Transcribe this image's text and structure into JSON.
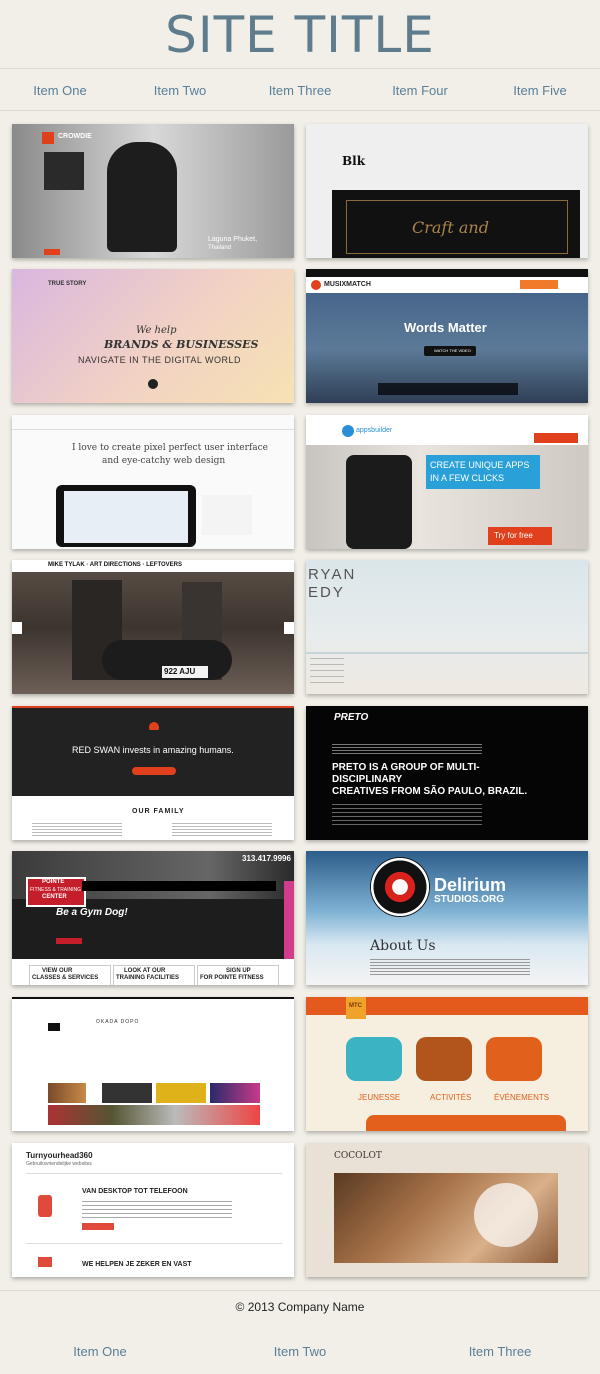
{
  "header": {
    "title": "SITE TITLE"
  },
  "nav": {
    "items": [
      "Item One",
      "Item Two",
      "Item Three",
      "Item Four",
      "Item Five"
    ]
  },
  "thumbnails": [
    {
      "name": "crowdie",
      "texts": [
        "CROWDIE",
        "Laguna Phuket,",
        "Thailand"
      ]
    },
    {
      "name": "blk",
      "texts": [
        "Blk",
        "Craft and"
      ]
    },
    {
      "name": "true-story",
      "texts": [
        "TRUE STORY",
        "We help",
        "BRANDS & BUSINESSES",
        "NAVIGATE IN THE DIGITAL WORLD"
      ]
    },
    {
      "name": "musixmatch",
      "texts": [
        "MUSIXMATCH",
        "Words Matter",
        "WATCH THE VIDEO"
      ]
    },
    {
      "name": "pixel-perfect",
      "texts": [
        "I love to create pixel perfect user interface",
        "and eye-catchy web design"
      ]
    },
    {
      "name": "appsbuilder",
      "texts": [
        "appsbuilder",
        "CREATE UNIQUE APPS",
        "IN A FEW CLICKS",
        "Try for free"
      ]
    },
    {
      "name": "mike-tylak",
      "texts": [
        "MIKE TYLAK · ART DIRECTIONS · LEFTOVERS",
        "922 AJU"
      ]
    },
    {
      "name": "ryan-edy",
      "texts": [
        "RYAN",
        "EDY"
      ]
    },
    {
      "name": "red-swan",
      "texts": [
        "RED SWAN invests in amazing humans.",
        "OUR FAMILY"
      ]
    },
    {
      "name": "preto",
      "texts": [
        "PRETO",
        "PRETO IS A GROUP OF MULTI-",
        "DISCIPLINARY",
        "CREATIVES FROM SÃO PAULO, BRAZIL."
      ]
    },
    {
      "name": "pointe-fitness",
      "texts": [
        "POINTE",
        "FITNESS & TRAINING",
        "CENTER",
        "Be a Gym Dog!",
        "VIEW OUR",
        "CLASSES & SERVICES",
        "LOOK AT OUR",
        "TRAINING FACILITIES",
        "SIGN UP",
        "FOR POINTE FITNESS",
        "313.417.9996"
      ]
    },
    {
      "name": "delirium",
      "texts": [
        "Delirium",
        "STUDIOS.ORG",
        "About Us"
      ]
    },
    {
      "name": "okada",
      "texts": [
        "OKADA DOPO"
      ]
    },
    {
      "name": "mtc",
      "texts": [
        "MTC",
        "JEUNESSE",
        "ACTIVITÉS",
        "ÉVÉNEMENTS"
      ]
    },
    {
      "name": "turnyourhead",
      "texts": [
        "Turnyourhead360",
        "Gebruiksvriendelijke websites",
        "VAN DESKTOP TOT TELEFOON",
        "WE HELPEN JE ZEKER EN VAST"
      ]
    },
    {
      "name": "cocolot",
      "texts": [
        "COCOLOT"
      ]
    }
  ],
  "footer": {
    "copyright": "© 2013 Company Name",
    "nav": [
      "Item One",
      "Item Two",
      "Item Three"
    ]
  }
}
